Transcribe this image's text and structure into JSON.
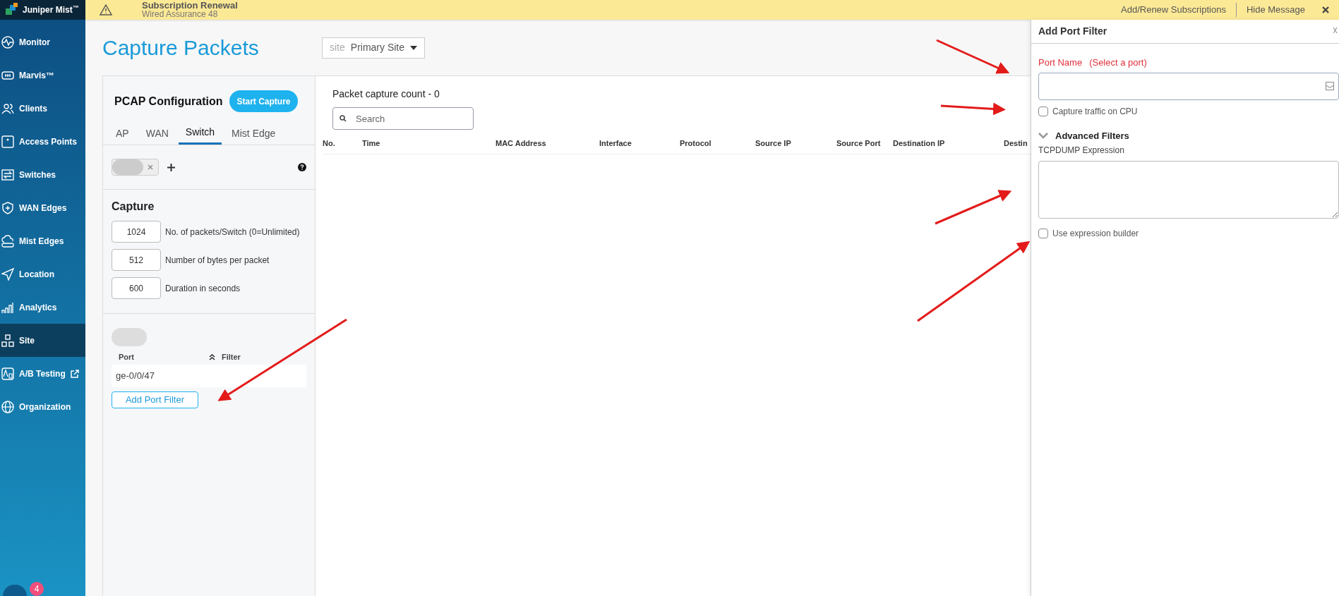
{
  "logo": {
    "text": "Juniper Mist$^{™}$"
  },
  "banner": {
    "title": "Subscription Renewal",
    "subtitle": "Wired Assurance 48",
    "links": [
      "Add/Renew Subscriptions",
      "Hide Message"
    ]
  },
  "sidebar": {
    "items": [
      {
        "label": "Monitor",
        "selected": false
      },
      {
        "label": "Marvis™",
        "selected": false
      },
      {
        "label": "Clients",
        "selected": false
      },
      {
        "label": "Access Points",
        "selected": false
      },
      {
        "label": "Switches",
        "selected": false
      },
      {
        "label": "WAN Edges",
        "selected": false
      },
      {
        "label": "Mist Edges",
        "selected": false
      },
      {
        "label": "Location",
        "selected": false
      },
      {
        "label": "Analytics",
        "selected": false
      },
      {
        "label": "Site",
        "selected": true
      },
      {
        "label": "A/B Testing",
        "selected": false,
        "external": true
      },
      {
        "label": "Organization",
        "selected": false
      }
    ],
    "badge": "4"
  },
  "page": {
    "title": "Capture Packets",
    "site_selector": {
      "prefix": "site",
      "value": "Primary Site"
    }
  },
  "pcap": {
    "title": "PCAP Configuration",
    "start_button": "Start Capture",
    "tabs": [
      {
        "label": "AP",
        "selected": false
      },
      {
        "label": "WAN",
        "selected": false
      },
      {
        "label": "Switch",
        "selected": true
      },
      {
        "label": "Mist Edge",
        "selected": false
      }
    ],
    "capture": {
      "heading": "Capture",
      "fields": [
        {
          "value": "1024",
          "label": "No. of packets/Switch (0=Unlimited)"
        },
        {
          "value": "512",
          "label": "Number of bytes per packet"
        },
        {
          "value": "600",
          "label": "Duration in seconds"
        }
      ]
    },
    "ports": {
      "columns": [
        "Port",
        "Filter"
      ],
      "rows": [
        "ge-0/0/47"
      ],
      "add_button": "Add Port Filter"
    }
  },
  "packets": {
    "count_label": "Packet capture count - 0",
    "search": {
      "placeholder": "Search"
    },
    "columns": [
      "No.",
      "Time",
      "MAC Address",
      "Interface",
      "Protocol",
      "Source IP",
      "Source Port",
      "Destination IP",
      "Destin"
    ]
  },
  "drawer": {
    "title": "Add Port Filter",
    "port_name": {
      "label": "Port Name",
      "hint": "(Select a port)"
    },
    "cpu_checkbox": {
      "label": "Capture traffic on CPU",
      "checked": false
    },
    "advanced": {
      "label": "Advanced Filters",
      "expanded": true
    },
    "tcpdump": {
      "label": "TCPDUMP Expression"
    },
    "builder_checkbox": {
      "label": "Use expression builder",
      "checked": false
    }
  }
}
